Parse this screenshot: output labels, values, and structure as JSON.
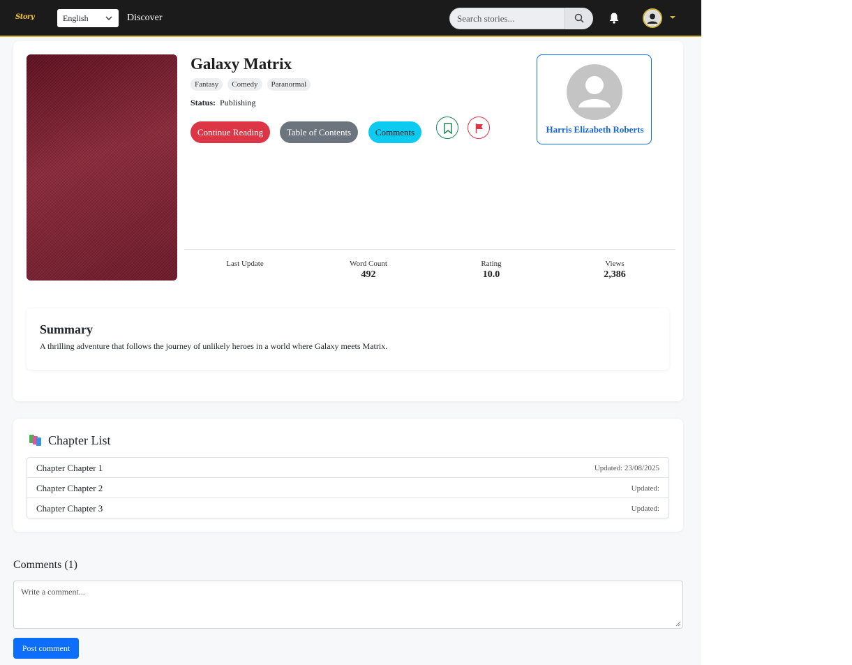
{
  "navbar": {
    "logo_text": "Story",
    "language": "English",
    "discover_label": "Discover",
    "search_placeholder": "Search stories...",
    "accent_color": "#d4b33a"
  },
  "story": {
    "title": "Galaxy Matrix",
    "tags": [
      "Fantasy",
      "Comedy",
      "Paranormal"
    ],
    "status_label": "Status:",
    "status_value": "Publishing",
    "buttons": {
      "continue": "Continue Reading",
      "toc": "Table of Contents",
      "comments": "Comments"
    },
    "icons": {
      "bookmark": "bookmark-icon",
      "report": "flag-icon"
    },
    "author_name": "Harris Elizabeth Roberts",
    "stats": [
      {
        "label": "Last Update",
        "value": ""
      },
      {
        "label": "Word Count",
        "value": "492"
      },
      {
        "label": "Rating",
        "value": "10.0"
      },
      {
        "label": "Views",
        "value": "2,386"
      }
    ],
    "summary_title": "Summary",
    "summary_text": "A thrilling adventure that follows the journey of unlikely heroes in a world where Galaxy meets Matrix."
  },
  "chapters": {
    "title": "Chapter List",
    "items": [
      {
        "name": "Chapter Chapter 1",
        "updated": "Updated: 23/08/2025"
      },
      {
        "name": "Chapter Chapter 2",
        "updated": "Updated:"
      },
      {
        "name": "Chapter Chapter 3",
        "updated": "Updated:"
      }
    ]
  },
  "comments": {
    "title": "Comments (1)",
    "placeholder": "Write a comment...",
    "post_label": "Post comment"
  },
  "colors": {
    "danger": "#dc3545",
    "secondary": "#6c757d",
    "info": "#0dcaf0",
    "primary": "#0d6efd",
    "success": "#198754"
  }
}
